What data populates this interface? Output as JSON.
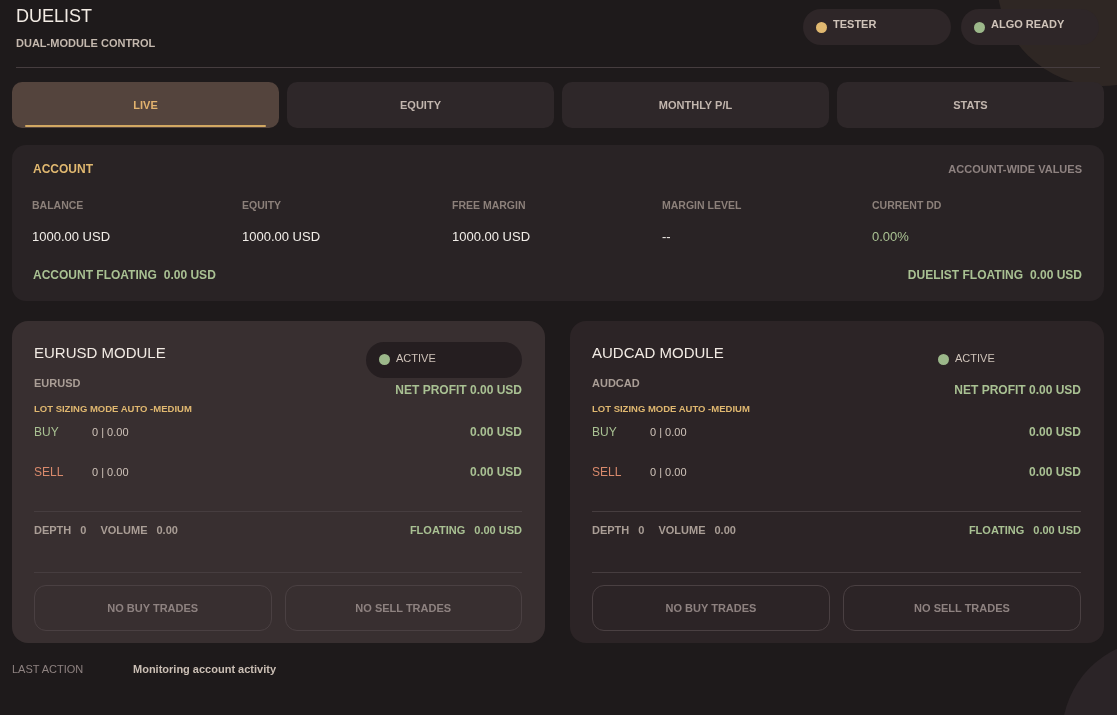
{
  "header": {
    "title": "DUELIST",
    "subtitle": "DUAL-MODULE CONTROL",
    "badges": [
      {
        "label": "TESTER",
        "color": "#e0b870"
      },
      {
        "label": "ALGO READY",
        "color": "#9cb88a"
      }
    ]
  },
  "tabs": [
    {
      "label": "LIVE",
      "selected": true
    },
    {
      "label": "EQUITY",
      "selected": false
    },
    {
      "label": "MONTHLY P/L",
      "selected": false
    },
    {
      "label": "STATS",
      "selected": false
    }
  ],
  "account": {
    "title": "ACCOUNT",
    "note": "ACCOUNT-WIDE VALUES",
    "metrics": [
      {
        "label": "BALANCE",
        "value": "1000.00 USD",
        "kind": "plain"
      },
      {
        "label": "EQUITY",
        "value": "1000.00 USD",
        "kind": "plain"
      },
      {
        "label": "FREE MARGIN",
        "value": "1000.00 USD",
        "kind": "plain"
      },
      {
        "label": "MARGIN LEVEL",
        "value": "--",
        "kind": "plain"
      },
      {
        "label": "CURRENT DD",
        "value": "0.00%",
        "kind": "positive"
      }
    ],
    "floating": [
      {
        "label": "ACCOUNT FLOATING",
        "value": "0.00 USD"
      },
      {
        "label": "DUELIST FLOATING",
        "value": "0.00 USD"
      }
    ]
  },
  "modules": [
    {
      "title": "EURUSD MODULE",
      "highlighted": true,
      "status": {
        "label": "ACTIVE",
        "color": "#9cb88a"
      },
      "symbol": "EURUSD",
      "net_profit": "NET PROFIT 0.00 USD",
      "lot_sizing": "LOT SIZING MODE AUTO -MEDIUM",
      "sides": [
        {
          "kind": "buy",
          "label": "BUY",
          "position": "0 | 0.00",
          "pnl": "0.00 USD"
        },
        {
          "kind": "sell",
          "label": "SELL",
          "position": "0 | 0.00",
          "pnl": "0.00 USD"
        }
      ],
      "stats": {
        "depth_label": "DEPTH",
        "depth": "0",
        "volume_label": "VOLUME",
        "volume": "0.00",
        "floating_label": "FLOATING",
        "floating": "0.00 USD"
      },
      "panels": [
        "NO BUY TRADES",
        "NO SELL TRADES"
      ]
    },
    {
      "title": "AUDCAD MODULE",
      "highlighted": false,
      "status": {
        "label": "ACTIVE",
        "color": "#9cb88a"
      },
      "symbol": "AUDCAD",
      "net_profit": "NET PROFIT 0.00 USD",
      "lot_sizing": "LOT SIZING MODE AUTO -MEDIUM",
      "sides": [
        {
          "kind": "buy",
          "label": "BUY",
          "position": "0 | 0.00",
          "pnl": "0.00 USD"
        },
        {
          "kind": "sell",
          "label": "SELL",
          "position": "0 | 0.00",
          "pnl": "0.00 USD"
        }
      ],
      "stats": {
        "depth_label": "DEPTH",
        "depth": "0",
        "volume_label": "VOLUME",
        "volume": "0.00",
        "floating_label": "FLOATING",
        "floating": "0.00 USD"
      },
      "panels": [
        "NO BUY TRADES",
        "NO SELL TRADES"
      ]
    }
  ],
  "last_action": {
    "label": "LAST ACTION",
    "text": "Monitoring account activity"
  }
}
